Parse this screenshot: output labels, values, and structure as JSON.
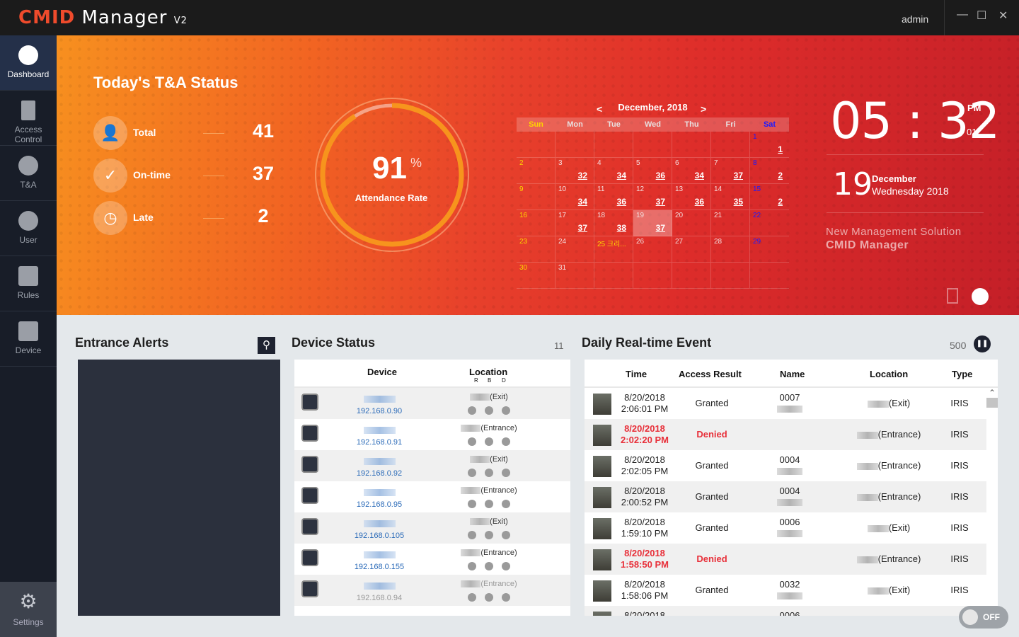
{
  "app": {
    "logo_a": "CMID",
    "logo_b": " Manager",
    "version": "V2",
    "user": "admin"
  },
  "window": {
    "minimize": "—",
    "maximize": "☐",
    "close": "✕"
  },
  "sidebar": {
    "items": [
      {
        "label": "Dashboard",
        "icon": "dashboard-icon",
        "active": true
      },
      {
        "label": "Access Control",
        "icon": "door-icon"
      },
      {
        "label": "T&A",
        "icon": "clock-icon"
      },
      {
        "label": "User",
        "icon": "user-icon"
      },
      {
        "label": "Rules",
        "icon": "calendar-check-icon"
      },
      {
        "label": "Device",
        "icon": "device-icon"
      }
    ],
    "settings": "Settings"
  },
  "ta": {
    "title": "Today's T&A Status",
    "stats": [
      {
        "label": "Total",
        "value": "41",
        "icon": "👤"
      },
      {
        "label": "On-time",
        "value": "37",
        "icon": "✓"
      },
      {
        "label": "Late",
        "value": "2",
        "icon": "◷"
      }
    ],
    "gauge": {
      "value": "91",
      "unit": "%",
      "label": "Attendance Rate",
      "fraction": 0.91
    }
  },
  "calendar": {
    "title": "December, 2018",
    "prev": "<",
    "next": ">",
    "dow": [
      "Sun",
      "Mon",
      "Tue",
      "Wed",
      "Thu",
      "Fri",
      "Sat"
    ],
    "cells": [
      [
        "",
        ""
      ],
      [
        "",
        ""
      ],
      [
        "",
        ""
      ],
      [
        "",
        ""
      ],
      [
        "",
        ""
      ],
      [
        "",
        ""
      ],
      [
        "1",
        "1"
      ],
      [
        "2",
        ""
      ],
      [
        "3",
        "32"
      ],
      [
        "4",
        "34"
      ],
      [
        "5",
        "36"
      ],
      [
        "6",
        "34"
      ],
      [
        "7",
        "37"
      ],
      [
        "8",
        "2"
      ],
      [
        "9",
        ""
      ],
      [
        "10",
        "34"
      ],
      [
        "11",
        "36"
      ],
      [
        "12",
        "37"
      ],
      [
        "13",
        "36"
      ],
      [
        "14",
        "35"
      ],
      [
        "15",
        "2"
      ],
      [
        "16",
        ""
      ],
      [
        "17",
        "37"
      ],
      [
        "18",
        "38"
      ],
      [
        "19",
        "37"
      ],
      [
        "20",
        ""
      ],
      [
        "21",
        ""
      ],
      [
        "22",
        ""
      ],
      [
        "23",
        ""
      ],
      [
        "24",
        ""
      ],
      [
        "25 크리...",
        ""
      ],
      [
        "26",
        ""
      ],
      [
        "27",
        ""
      ],
      [
        "28",
        ""
      ],
      [
        "29",
        ""
      ],
      [
        "30",
        ""
      ],
      [
        "31",
        ""
      ],
      [
        "",
        ""
      ],
      [
        "",
        ""
      ],
      [
        "",
        ""
      ],
      [
        "",
        ""
      ],
      [
        "",
        ""
      ]
    ],
    "today": "19",
    "sun_color": "#ffd400",
    "sat_color": "#1a1aff"
  },
  "clock": {
    "time": "05 : 32",
    "ampm": "PM",
    "seconds": "01",
    "day": "19",
    "month": "December",
    "weekday_year": "Wednesday 2018"
  },
  "slogan": {
    "line1": "New Management Solution",
    "line2": "CMID Manager"
  },
  "alerts": {
    "title": "Entrance Alerts"
  },
  "devices": {
    "title": "Device Status",
    "count": "11",
    "headers": {
      "device": "Device",
      "location": "Location",
      "r": "R",
      "b": "B",
      "d": "D"
    },
    "rows": [
      {
        "ip": "192.168.0.90",
        "loc": "(Exit)"
      },
      {
        "ip": "192.168.0.91",
        "loc": "(Entrance)"
      },
      {
        "ip": "192.168.0.92",
        "loc": "(Exit)"
      },
      {
        "ip": "192.168.0.95",
        "loc": "(Entrance)"
      },
      {
        "ip": "192.168.0.105",
        "loc": "(Exit)"
      },
      {
        "ip": "192.168.0.155",
        "loc": "(Entrance)"
      },
      {
        "ip": "192.168.0.94",
        "loc": "(Entrance)",
        "offline": true
      }
    ]
  },
  "events": {
    "title": "Daily Real-time Event",
    "count": "500",
    "headers": [
      "Time",
      "Access Result",
      "Name",
      "Location",
      "Type"
    ],
    "rows": [
      {
        "date": "8/20/2018",
        "time": "2:06:01 PM",
        "result": "Granted",
        "name": "0007",
        "loc": "(Exit)",
        "type": "IRIS"
      },
      {
        "date": "8/20/2018",
        "time": "2:02:20 PM",
        "result": "Denied",
        "name": "",
        "loc": "(Entrance)",
        "type": "IRIS"
      },
      {
        "date": "8/20/2018",
        "time": "2:02:05 PM",
        "result": "Granted",
        "name": "0004",
        "loc": "(Entrance)",
        "type": "IRIS"
      },
      {
        "date": "8/20/2018",
        "time": "2:00:52 PM",
        "result": "Granted",
        "name": "0004",
        "loc": "(Entrance)",
        "type": "IRIS"
      },
      {
        "date": "8/20/2018",
        "time": "1:59:10 PM",
        "result": "Granted",
        "name": "0006",
        "loc": "(Exit)",
        "type": "IRIS"
      },
      {
        "date": "8/20/2018",
        "time": "1:58:50 PM",
        "result": "Denied",
        "name": "",
        "loc": "(Entrance)",
        "type": "IRIS"
      },
      {
        "date": "8/20/2018",
        "time": "1:58:06 PM",
        "result": "Granted",
        "name": "0032",
        "loc": "(Exit)",
        "type": "IRIS"
      },
      {
        "date": "8/20/2018",
        "time": "",
        "result": "",
        "name": "0006",
        "loc": "",
        "type": ""
      }
    ],
    "toggle": "OFF"
  }
}
